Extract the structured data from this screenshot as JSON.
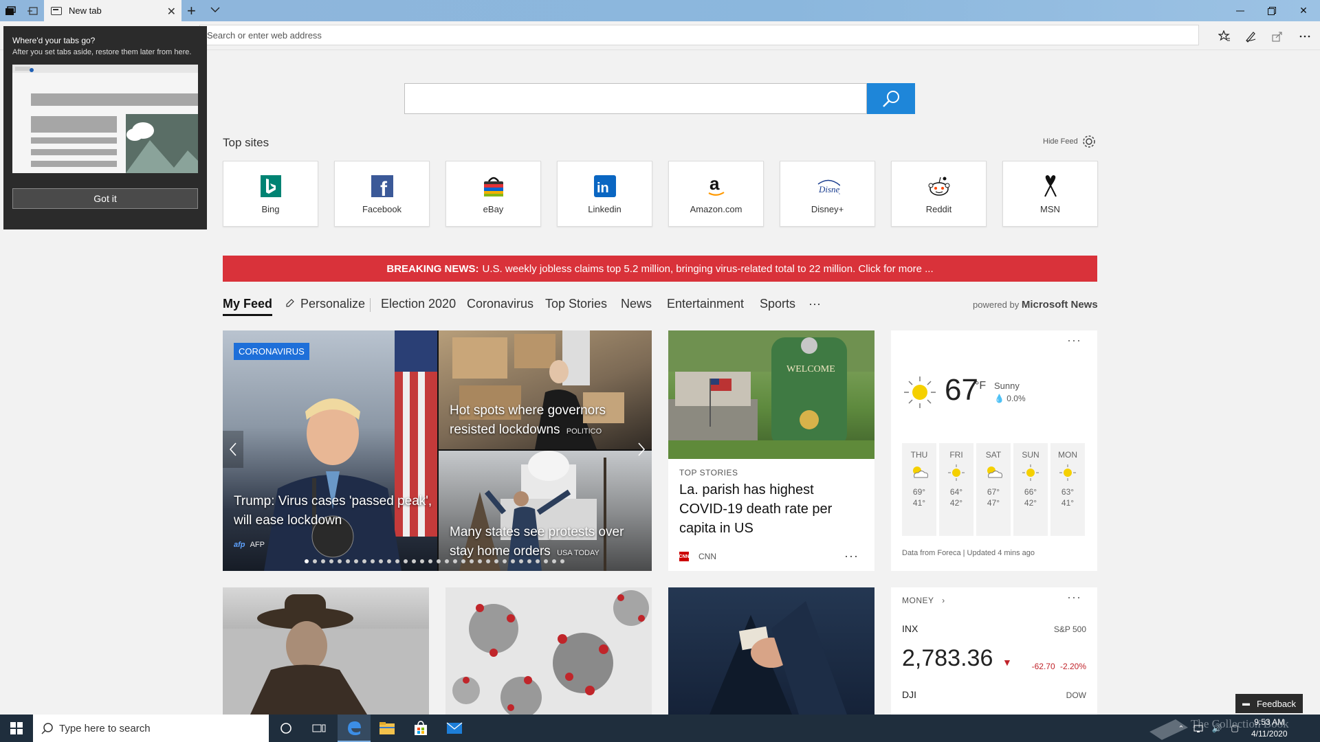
{
  "browser": {
    "tab_title": "New tab",
    "address_placeholder": "Search or enter web address"
  },
  "tabs_popup": {
    "title": "Where'd your tabs go?",
    "body": "After you set tabs aside, restore them later from here.",
    "button": "Got it"
  },
  "new_tab": {
    "top_sites_title": "Top sites",
    "hide_feed": "Hide Feed",
    "sites": [
      {
        "label": "Bing",
        "icon": "bing-logo"
      },
      {
        "label": "Facebook",
        "icon": "facebook-logo"
      },
      {
        "label": "eBay",
        "icon": "ebay-logo"
      },
      {
        "label": "Linkedin",
        "icon": "linkedin-logo"
      },
      {
        "label": "Amazon.com",
        "icon": "amazon-logo"
      },
      {
        "label": "Disney+",
        "icon": "disney-logo"
      },
      {
        "label": "Reddit",
        "icon": "reddit-logo"
      },
      {
        "label": "MSN",
        "icon": "msn-logo"
      }
    ],
    "breaking_label": "BREAKING NEWS:",
    "breaking_text": "U.S. weekly jobless claims top 5.2 million, bringing virus-related total to 22 million. Click for more ...",
    "feed_tabs": [
      "My Feed",
      "Personalize",
      "Election 2020",
      "Coronavirus",
      "Top Stories",
      "News",
      "Entertainment",
      "Sports",
      "···"
    ],
    "powered_by": "powered by",
    "powered_brand": "Microsoft News"
  },
  "cards": {
    "hero": {
      "tag": "CORONAVIRUS",
      "headline": "Trump: Virus cases 'passed peak', will ease lockdown",
      "source": "AFP"
    },
    "side_top": {
      "headline": "Hot spots where governors resisted lockdowns",
      "source": "POLITICO"
    },
    "side_bottom": {
      "headline": "Many states see protests over stay home orders",
      "source": "USA TODAY"
    },
    "story": {
      "category": "TOP STORIES",
      "headline": "La. parish has highest COVID-19 death rate per capita in US",
      "source": "CNN",
      "more": "···"
    },
    "weather": {
      "temp": "67",
      "unit": "°F",
      "condition": "Sunny",
      "precip": "0.0%",
      "more": "···",
      "forecast": [
        {
          "day": "THU",
          "hi": "69°",
          "lo": "41°",
          "icon": "partly-cloudy"
        },
        {
          "day": "FRI",
          "hi": "64°",
          "lo": "42°",
          "icon": "sunny"
        },
        {
          "day": "SAT",
          "hi": "67°",
          "lo": "47°",
          "icon": "partly-cloudy"
        },
        {
          "day": "SUN",
          "hi": "66°",
          "lo": "42°",
          "icon": "sunny"
        },
        {
          "day": "MON",
          "hi": "63°",
          "lo": "41°",
          "icon": "sunny"
        }
      ],
      "footer": "Data from Foreca | Updated 4 mins ago"
    },
    "money": {
      "title": "MONEY",
      "more": "···",
      "index1_sym": "INX",
      "index1_name": "S&P 500",
      "index1_value": "2,783.36",
      "index1_change": "-62.70",
      "index1_pct": "-2.20%",
      "index2_sym": "DJI",
      "index2_name": "DOW"
    }
  },
  "feedback": "Feedback",
  "taskbar": {
    "search_placeholder": "Type here to search",
    "time": "9:53 AM",
    "date": "4/11/2020",
    "watermark": "The Collection Book"
  }
}
